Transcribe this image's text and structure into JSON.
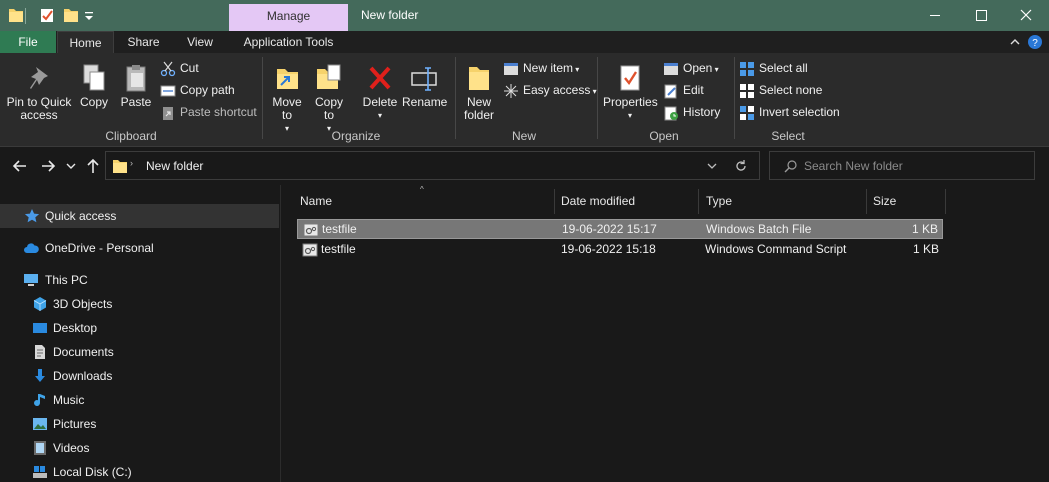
{
  "window": {
    "title": "New folder",
    "contextual_tab": "Manage",
    "accent": "#446a5b",
    "manage_color": "#e4c8f5"
  },
  "tabs": [
    "File",
    "Home",
    "Share",
    "View",
    "Application Tools"
  ],
  "ribbon": {
    "clipboard": {
      "label": "Clipboard",
      "pin": "Pin to Quick access",
      "copy": "Copy",
      "paste": "Paste",
      "cut": "Cut",
      "copy_path": "Copy path",
      "paste_shortcut": "Paste shortcut"
    },
    "organize": {
      "label": "Organize",
      "move_to": "Move to",
      "copy_to": "Copy to",
      "delete": "Delete",
      "rename": "Rename"
    },
    "new": {
      "label": "New",
      "new_folder": "New folder",
      "new_item": "New item",
      "easy_access": "Easy access"
    },
    "open": {
      "label": "Open",
      "properties": "Properties",
      "open": "Open",
      "edit": "Edit",
      "history": "History"
    },
    "select": {
      "label": "Select",
      "select_all": "Select all",
      "select_none": "Select none",
      "invert_selection": "Invert selection"
    }
  },
  "address": {
    "path": "New folder",
    "search_placeholder": "Search New folder"
  },
  "nav_pane": [
    {
      "label": "Quick access",
      "icon": "star-icon",
      "selected": true
    },
    {
      "label": "OneDrive - Personal",
      "icon": "cloud-icon"
    },
    {
      "label": "This PC",
      "icon": "computer-icon"
    },
    {
      "label": "3D Objects",
      "icon": "cube-icon"
    },
    {
      "label": "Desktop",
      "icon": "desktop-icon"
    },
    {
      "label": "Documents",
      "icon": "document-icon"
    },
    {
      "label": "Downloads",
      "icon": "download-icon"
    },
    {
      "label": "Music",
      "icon": "music-icon"
    },
    {
      "label": "Pictures",
      "icon": "pictures-icon"
    },
    {
      "label": "Videos",
      "icon": "video-icon"
    },
    {
      "label": "Local Disk (C:)",
      "icon": "drive-icon"
    }
  ],
  "file_list": {
    "columns": [
      "Name",
      "Date modified",
      "Type",
      "Size"
    ],
    "rows": [
      {
        "name": "testfile",
        "date": "19-06-2022 15:17",
        "type": "Windows Batch File",
        "size": "1 KB",
        "selected": true
      },
      {
        "name": "testfile",
        "date": "19-06-2022 15:18",
        "type": "Windows Command Script",
        "size": "1 KB"
      }
    ]
  }
}
